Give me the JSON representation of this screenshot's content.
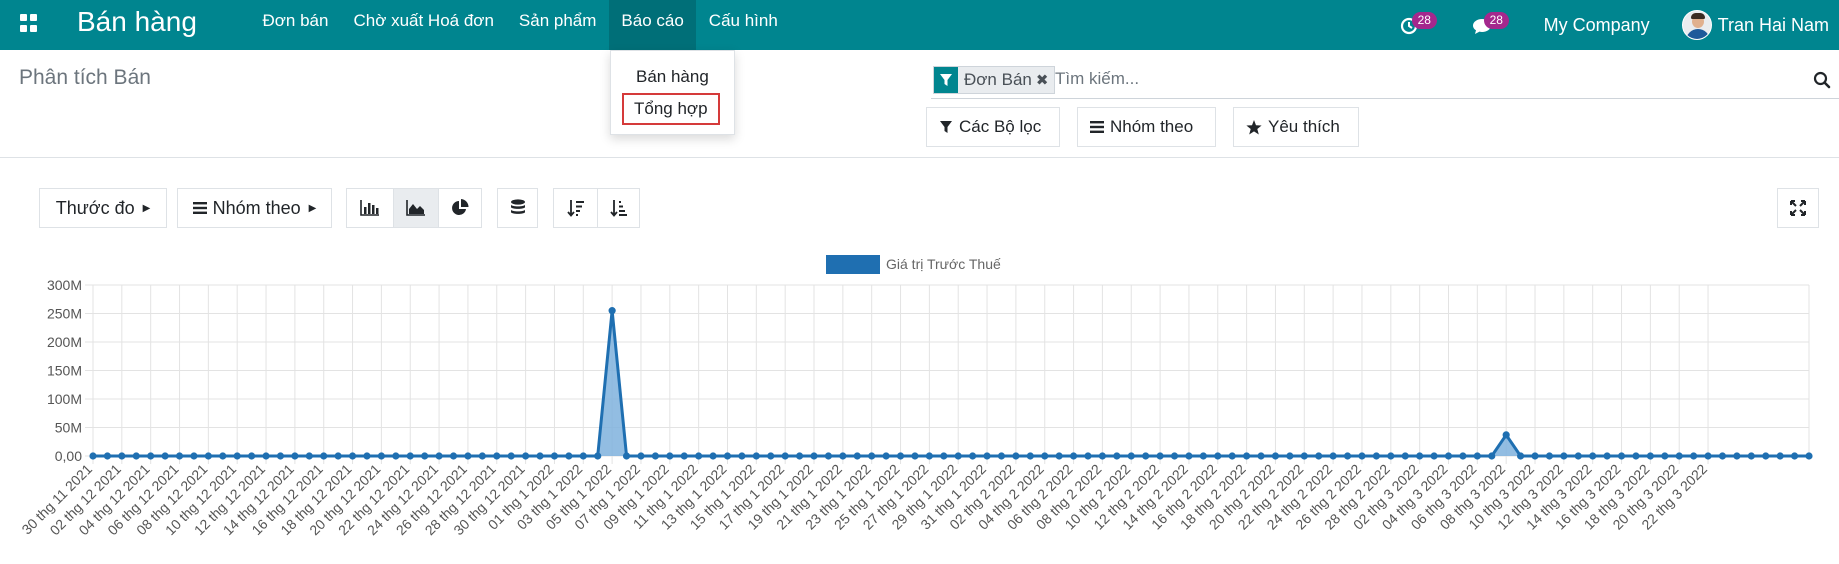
{
  "navbar": {
    "app_title": "Bán hàng",
    "menu": [
      "Đơn bán",
      "Chờ xuất Hoá đơn",
      "Sản phẩm",
      "Báo cáo",
      "Cấu hình"
    ],
    "active_menu_index": 3,
    "activity_badge": "28",
    "messages_badge": "28",
    "company": "My Company",
    "user": "Tran Hai Nam",
    "bg_color": "#00858f"
  },
  "dropdown": {
    "items": [
      "Bán hàng",
      "Tổng hợp"
    ],
    "highlighted_index": 1,
    "highlight_color": "#d53a3a"
  },
  "control_panel": {
    "breadcrumb": "Phân tích Bán",
    "facet": "Đơn Bán",
    "search_placeholder": "Tìm kiếm...",
    "filters_label": "Các Bộ lọc",
    "groupby_label": "Nhóm theo",
    "favorites_label": "Yêu thích"
  },
  "graph_toolbar": {
    "measures_label": "Thước đo",
    "groupby_label": "Nhóm theo",
    "active_chart": "line"
  },
  "chart_data": {
    "type": "area",
    "title": "",
    "xlabel": "",
    "ylabel": "",
    "series": [
      {
        "name": "Giá trị Trước Thuế",
        "color": "#1f6fb1",
        "values": [
          0,
          0,
          0,
          0,
          0,
          0,
          0,
          0,
          0,
          0,
          0,
          0,
          0,
          0,
          0,
          0,
          0,
          0,
          0,
          0,
          0,
          0,
          0,
          0,
          0,
          0,
          0,
          0,
          0,
          0,
          0,
          0,
          0,
          0,
          0,
          0,
          255000000,
          0,
          0,
          0,
          0,
          0,
          0,
          0,
          0,
          0,
          0,
          0,
          0,
          0,
          0,
          0,
          0,
          0,
          0,
          0,
          0,
          0,
          0,
          0,
          0,
          0,
          0,
          0,
          0,
          0,
          0,
          0,
          0,
          0,
          0,
          0,
          0,
          0,
          0,
          0,
          0,
          0,
          0,
          0,
          0,
          0,
          0,
          0,
          0,
          0,
          0,
          0,
          0,
          0,
          0,
          0,
          0,
          0,
          0,
          0,
          0,
          0,
          37000000,
          0,
          0,
          0,
          0,
          0,
          0,
          0,
          0,
          0,
          0,
          0,
          0,
          0,
          0,
          0,
          0,
          0,
          0,
          0,
          0,
          0
        ]
      }
    ],
    "x_tick_labels": [
      "30 thg 11 2021",
      "02 thg 12 2021",
      "04 thg 12 2021",
      "06 thg 12 2021",
      "08 thg 12 2021",
      "10 thg 12 2021",
      "12 thg 12 2021",
      "14 thg 12 2021",
      "16 thg 12 2021",
      "18 thg 12 2021",
      "20 thg 12 2021",
      "22 thg 12 2021",
      "24 thg 12 2021",
      "26 thg 12 2021",
      "28 thg 12 2021",
      "30 thg 12 2021",
      "01 thg 1 2022",
      "03 thg 1 2022",
      "05 thg 1 2022",
      "07 thg 1 2022",
      "09 thg 1 2022",
      "11 thg 1 2022",
      "13 thg 1 2022",
      "15 thg 1 2022",
      "17 thg 1 2022",
      "19 thg 1 2022",
      "21 thg 1 2022",
      "23 thg 1 2022",
      "25 thg 1 2022",
      "27 thg 1 2022",
      "29 thg 1 2022",
      "31 thg 1 2022",
      "02 thg 2 2022",
      "04 thg 2 2022",
      "06 thg 2 2022",
      "08 thg 2 2022",
      "10 thg 2 2022",
      "12 thg 2 2022",
      "14 thg 2 2022",
      "16 thg 2 2022",
      "18 thg 2 2022",
      "20 thg 2 2022",
      "22 thg 2 2022",
      "24 thg 2 2022",
      "26 thg 2 2022",
      "28 thg 2 2022",
      "02 thg 3 2022",
      "04 thg 3 2022",
      "06 thg 3 2022",
      "08 thg 3 2022",
      "10 thg 3 2022",
      "12 thg 3 2022",
      "14 thg 3 2022",
      "16 thg 3 2022",
      "18 thg 3 2022",
      "20 thg 3 2022",
      "22 thg 3 2022"
    ],
    "y_ticks": [
      "0,00",
      "50M",
      "100M",
      "150M",
      "200M",
      "250M",
      "300M"
    ],
    "ylim": [
      0,
      300000000
    ],
    "grid": true,
    "legend_position": "top-center"
  }
}
